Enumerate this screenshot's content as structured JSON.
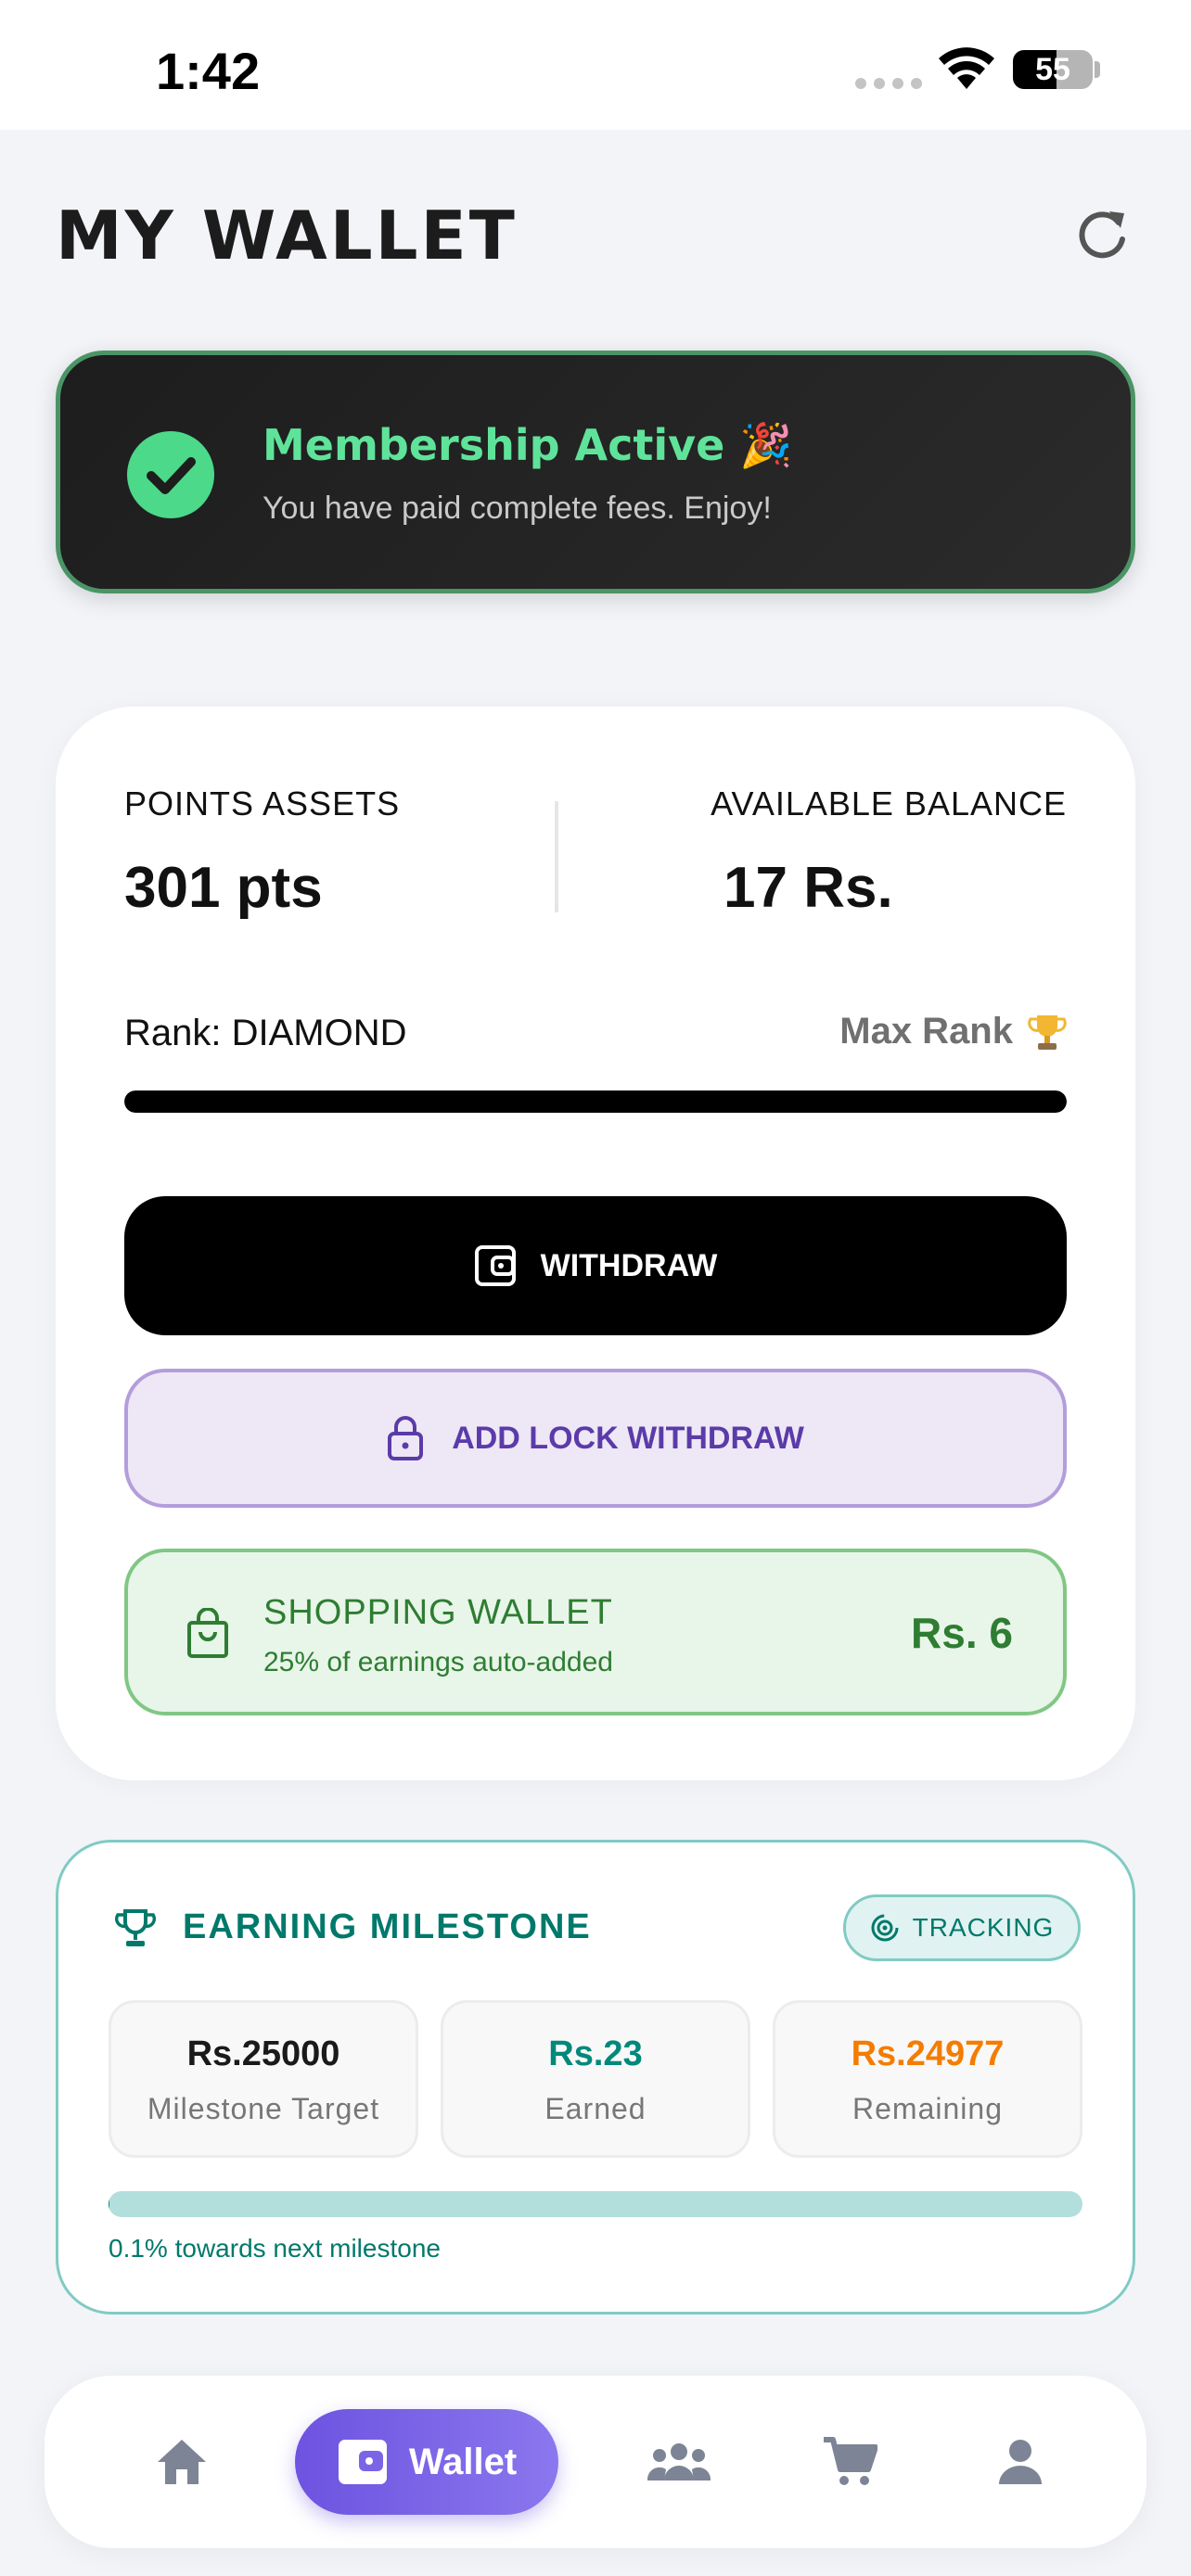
{
  "status_bar": {
    "time": "1:42",
    "battery": "55"
  },
  "header": {
    "title": "MY WALLET"
  },
  "membership": {
    "title": "Membership Active 🎉",
    "subtitle": "You have paid complete fees. Enjoy!"
  },
  "wallet": {
    "points_label": "POINTS ASSETS",
    "points_value": "301 pts",
    "balance_label": "AVAILABLE BALANCE",
    "balance_value": "17 Rs.",
    "rank_label": "Rank: DIAMOND",
    "max_rank_label": "Max Rank",
    "rank_progress": 1.0,
    "withdraw_label": "WITHDRAW",
    "lock_withdraw_label": "ADD LOCK WITHDRAW",
    "shopping": {
      "title": "SHOPPING WALLET",
      "subtitle": "25% of earnings auto-added",
      "amount": "Rs. 6"
    }
  },
  "milestone": {
    "title": "EARNING MILESTONE",
    "badge": "TRACKING",
    "target_value": "Rs.25000",
    "target_label": "Milestone Target",
    "earned_value": "Rs.23",
    "earned_label": "Earned",
    "remaining_value": "Rs.24977",
    "remaining_label": "Remaining",
    "progress_percent": 0.1,
    "progress_text": "0.1% towards next milestone"
  },
  "nav": {
    "items": [
      {
        "icon": "home-icon"
      },
      {
        "icon": "wallet-icon",
        "label": "Wallet",
        "active": true
      },
      {
        "icon": "community-icon"
      },
      {
        "icon": "cart-icon"
      },
      {
        "icon": "profile-icon"
      }
    ]
  },
  "colors": {
    "accent": "#6d53e0",
    "success": "#4cd98a",
    "teal": "#00796b",
    "orange": "#f57c00",
    "shopping_green": "#2e7d32",
    "lock_purple": "#5b3ba8"
  }
}
